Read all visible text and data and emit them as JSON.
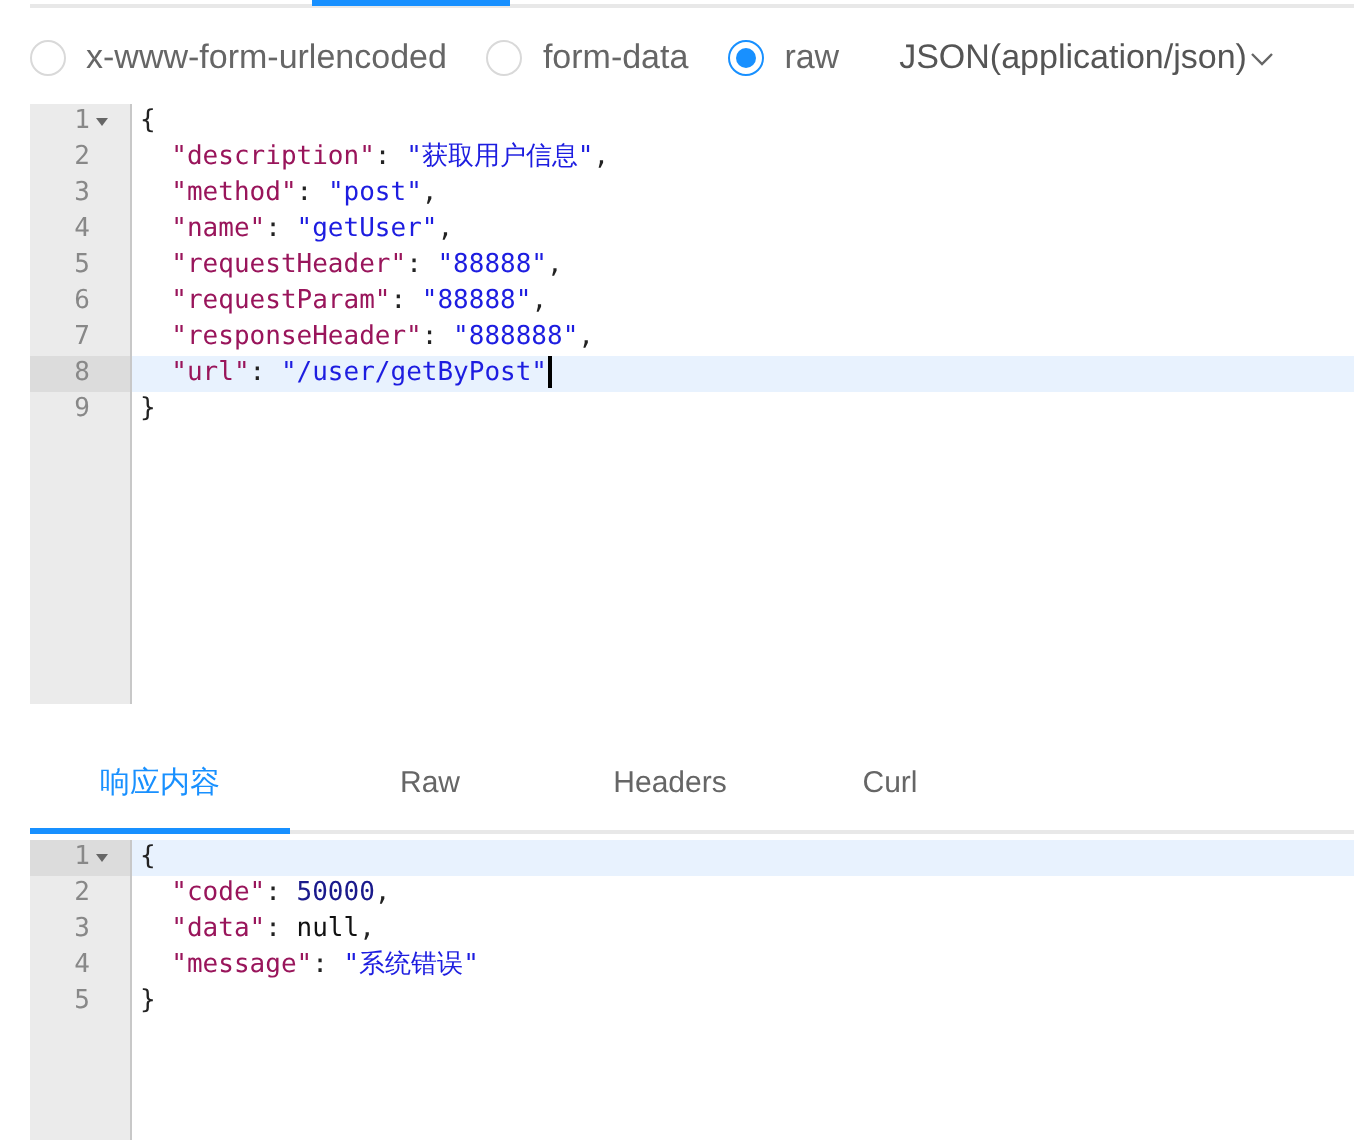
{
  "body_types": [
    {
      "label": "x-www-form-urlencoded",
      "selected": false
    },
    {
      "label": "form-data",
      "selected": false
    },
    {
      "label": "raw",
      "selected": true
    }
  ],
  "format_dropdown": {
    "value": "JSON(application/json)"
  },
  "request_editor": {
    "lines": [
      {
        "number": "1",
        "foldable": true,
        "active": false,
        "cursor": false,
        "tokens": [
          {
            "kind": "punct",
            "text": "{"
          }
        ]
      },
      {
        "number": "2",
        "foldable": false,
        "active": false,
        "cursor": false,
        "tokens": [
          {
            "kind": "key",
            "text": "  \"description\""
          },
          {
            "kind": "punct",
            "text": ": "
          },
          {
            "kind": "string",
            "text": "\"获取用户信息\""
          },
          {
            "kind": "punct",
            "text": ","
          }
        ]
      },
      {
        "number": "3",
        "foldable": false,
        "active": false,
        "cursor": false,
        "tokens": [
          {
            "kind": "key",
            "text": "  \"method\""
          },
          {
            "kind": "punct",
            "text": ": "
          },
          {
            "kind": "string",
            "text": "\"post\""
          },
          {
            "kind": "punct",
            "text": ","
          }
        ]
      },
      {
        "number": "4",
        "foldable": false,
        "active": false,
        "cursor": false,
        "tokens": [
          {
            "kind": "key",
            "text": "  \"name\""
          },
          {
            "kind": "punct",
            "text": ": "
          },
          {
            "kind": "string",
            "text": "\"getUser\""
          },
          {
            "kind": "punct",
            "text": ","
          }
        ]
      },
      {
        "number": "5",
        "foldable": false,
        "active": false,
        "cursor": false,
        "tokens": [
          {
            "kind": "key",
            "text": "  \"requestHeader\""
          },
          {
            "kind": "punct",
            "text": ": "
          },
          {
            "kind": "string",
            "text": "\"88888\""
          },
          {
            "kind": "punct",
            "text": ","
          }
        ]
      },
      {
        "number": "6",
        "foldable": false,
        "active": false,
        "cursor": false,
        "tokens": [
          {
            "kind": "key",
            "text": "  \"requestParam\""
          },
          {
            "kind": "punct",
            "text": ": "
          },
          {
            "kind": "string",
            "text": "\"88888\""
          },
          {
            "kind": "punct",
            "text": ","
          }
        ]
      },
      {
        "number": "7",
        "foldable": false,
        "active": false,
        "cursor": false,
        "tokens": [
          {
            "kind": "key",
            "text": "  \"responseHeader\""
          },
          {
            "kind": "punct",
            "text": ": "
          },
          {
            "kind": "string",
            "text": "\"888888\""
          },
          {
            "kind": "punct",
            "text": ","
          }
        ]
      },
      {
        "number": "8",
        "foldable": false,
        "active": true,
        "cursor": true,
        "tokens": [
          {
            "kind": "key",
            "text": "  \"url\""
          },
          {
            "kind": "punct",
            "text": ": "
          },
          {
            "kind": "string",
            "text": "\"/user/getByPost\""
          }
        ]
      },
      {
        "number": "9",
        "foldable": false,
        "active": false,
        "cursor": false,
        "tokens": [
          {
            "kind": "punct",
            "text": "}"
          }
        ]
      }
    ]
  },
  "response_tabs": [
    {
      "label": "响应内容",
      "selected": true
    },
    {
      "label": "Raw",
      "selected": false
    },
    {
      "label": "Headers",
      "selected": false
    },
    {
      "label": "Curl",
      "selected": false
    }
  ],
  "response_editor": {
    "lines": [
      {
        "number": "1",
        "foldable": true,
        "active": true,
        "cursor": false,
        "tokens": [
          {
            "kind": "punct",
            "text": "{"
          }
        ]
      },
      {
        "number": "2",
        "foldable": false,
        "active": false,
        "cursor": false,
        "tokens": [
          {
            "kind": "key",
            "text": "  \"code\""
          },
          {
            "kind": "punct",
            "text": ": "
          },
          {
            "kind": "number",
            "text": "50000"
          },
          {
            "kind": "punct",
            "text": ","
          }
        ]
      },
      {
        "number": "3",
        "foldable": false,
        "active": false,
        "cursor": false,
        "tokens": [
          {
            "kind": "key",
            "text": "  \"data\""
          },
          {
            "kind": "punct",
            "text": ": "
          },
          {
            "kind": "atom",
            "text": "null"
          },
          {
            "kind": "punct",
            "text": ","
          }
        ]
      },
      {
        "number": "4",
        "foldable": false,
        "active": false,
        "cursor": false,
        "tokens": [
          {
            "kind": "key",
            "text": "  \"message\""
          },
          {
            "kind": "punct",
            "text": ": "
          },
          {
            "kind": "string",
            "text": "\"系统错误\""
          }
        ]
      },
      {
        "number": "5",
        "foldable": false,
        "active": false,
        "cursor": false,
        "tokens": [
          {
            "kind": "punct",
            "text": "}"
          }
        ]
      }
    ]
  }
}
